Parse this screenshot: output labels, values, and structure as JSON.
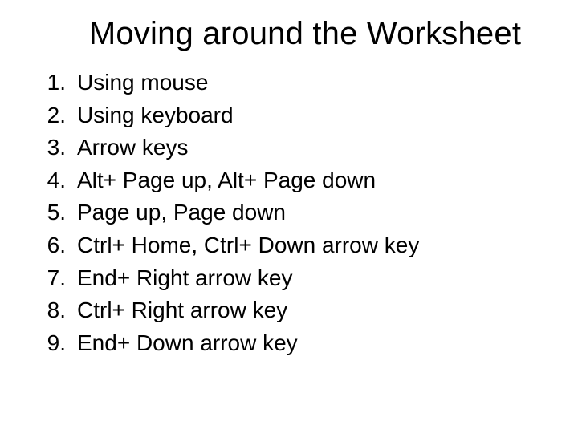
{
  "title": "Moving around the Worksheet",
  "items": [
    {
      "num": "1.",
      "text": "Using mouse"
    },
    {
      "num": "2.",
      "text": "Using keyboard"
    },
    {
      "num": "3.",
      "text": "Arrow keys"
    },
    {
      "num": "4.",
      "text": "Alt+ Page up, Alt+ Page down"
    },
    {
      "num": "5.",
      "text": "Page up, Page down"
    },
    {
      "num": "6.",
      "text": "Ctrl+ Home, Ctrl+ Down arrow key"
    },
    {
      "num": "7.",
      "text": "End+ Right arrow key"
    },
    {
      "num": "8.",
      "text": "Ctrl+ Right arrow key"
    },
    {
      "num": "9.",
      "text": "End+ Down arrow key"
    }
  ]
}
